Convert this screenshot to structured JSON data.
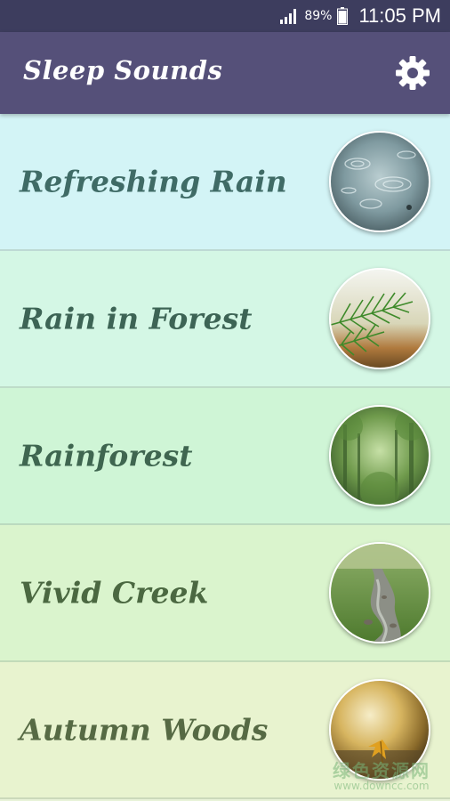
{
  "status_bar": {
    "battery_percent": "89%",
    "time": "11:05 PM",
    "icons": [
      "signal-icon",
      "battery-icon"
    ]
  },
  "app_bar": {
    "title": "Sleep Sounds",
    "settings_icon": "gear-icon"
  },
  "sounds": [
    {
      "label": "Refreshing Rain",
      "text_color": "#3f6b66",
      "bg_color": "#d3f4f6",
      "thumb": "rain-drops-image"
    },
    {
      "label": "Rain in Forest",
      "text_color": "#3d6455",
      "bg_color": "#d4f7e5",
      "thumb": "pine-branch-image"
    },
    {
      "label": "Rainforest",
      "text_color": "#3f6650",
      "bg_color": "#cff5d6",
      "thumb": "misty-forest-image"
    },
    {
      "label": "Vivid Creek",
      "text_color": "#4b6841",
      "bg_color": "#daf4cd",
      "thumb": "creek-image"
    },
    {
      "label": "Autumn Woods",
      "text_color": "#566a44",
      "bg_color": "#e8f3cf",
      "thumb": "autumn-leaves-image"
    }
  ],
  "watermark": {
    "line1": "绿色资源网",
    "line2": "www.downcc.com"
  },
  "colors": {
    "status_bar": "#3d3d5e",
    "app_bar": "#555079",
    "title_text": "#ffffff"
  }
}
